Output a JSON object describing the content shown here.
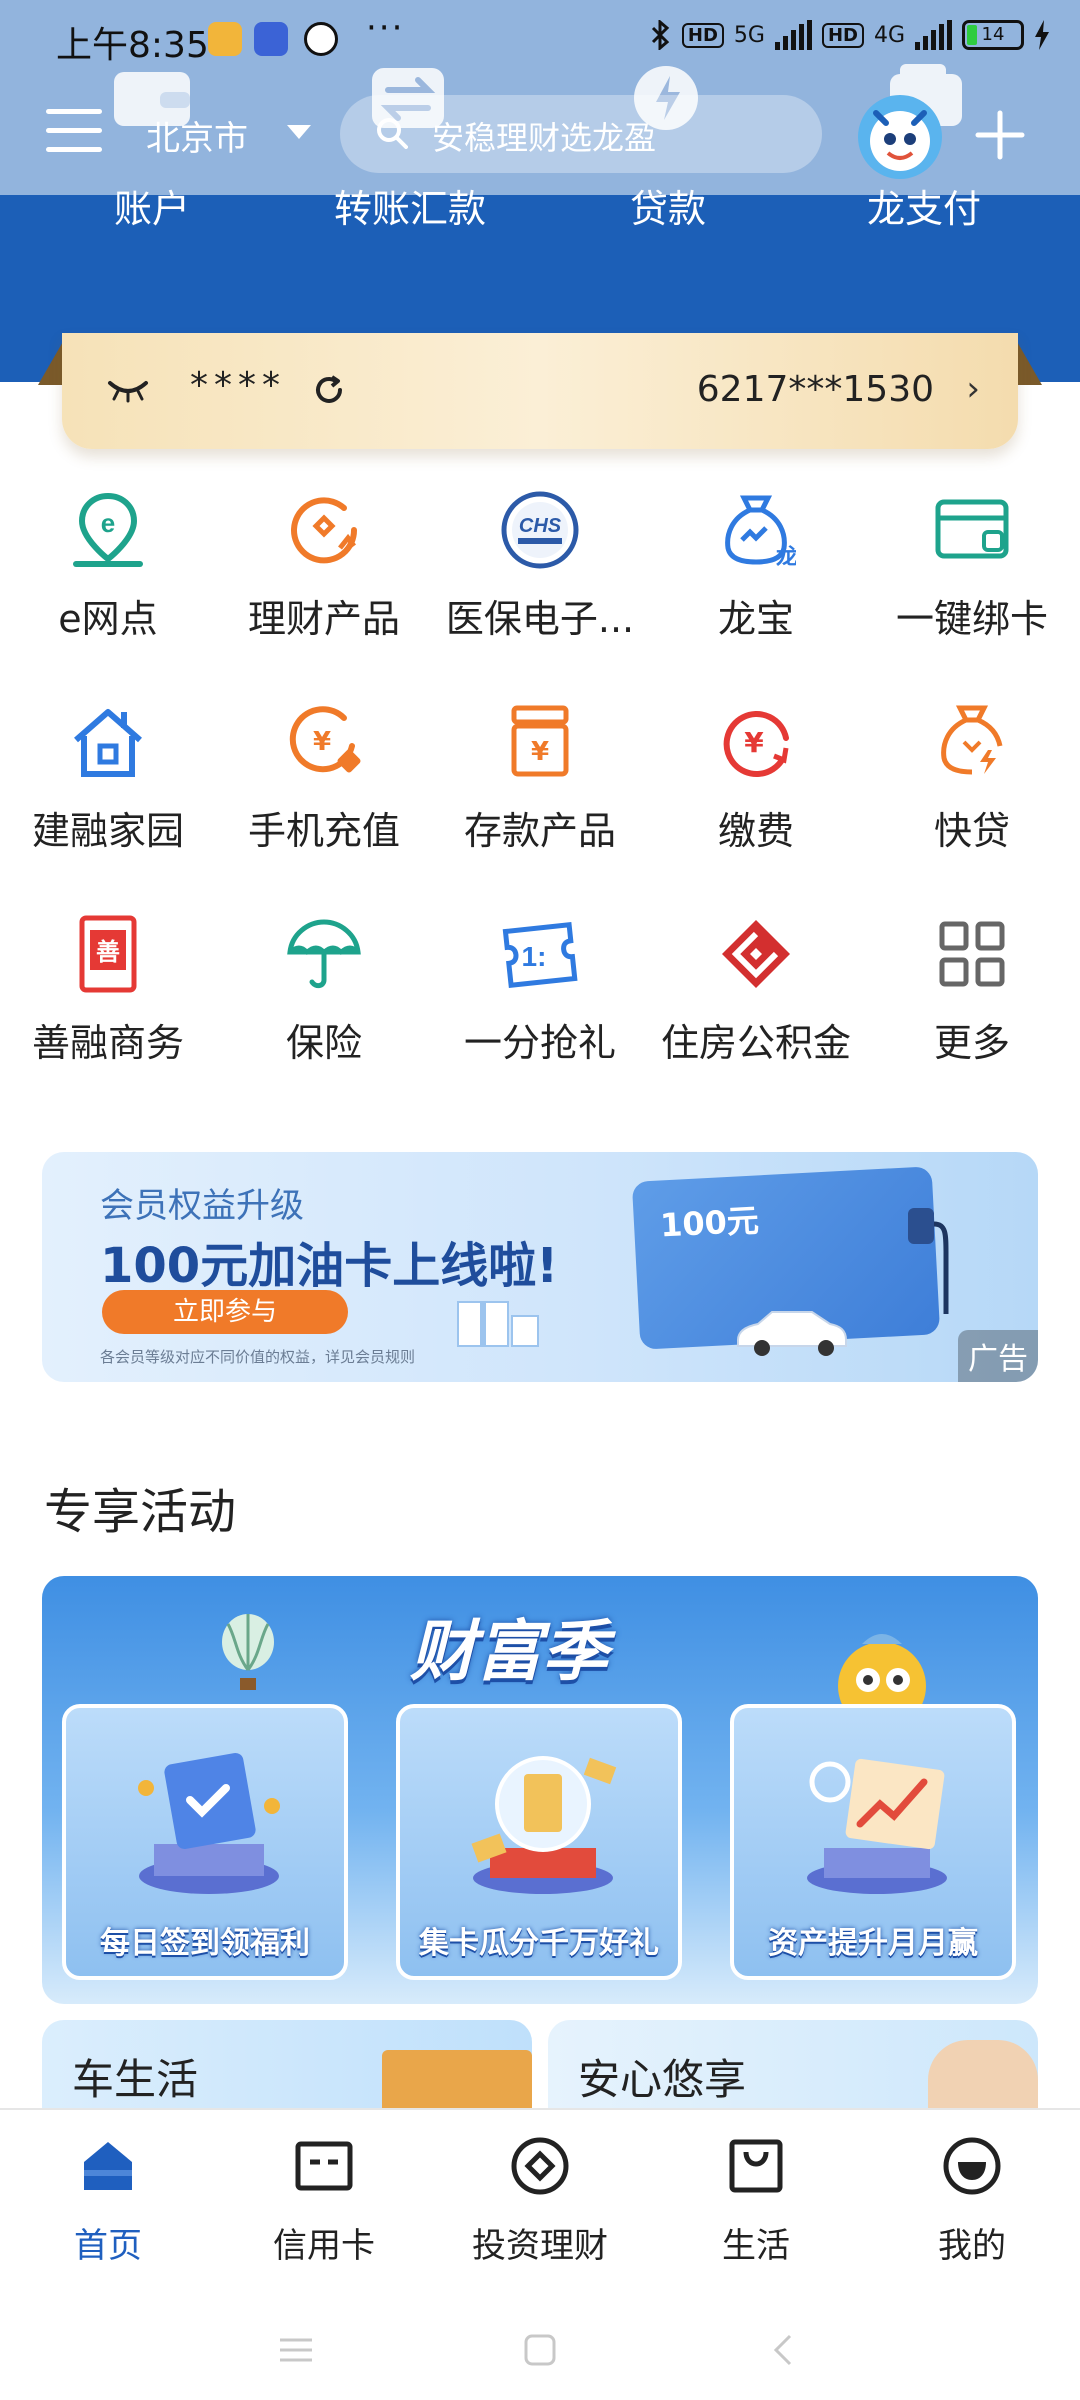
{
  "status_bar": {
    "time": "上午8:35",
    "dots": "···",
    "signal_1": "5G",
    "signal_2": "4G",
    "hd": "HD",
    "battery": "14"
  },
  "header": {
    "city": "北京市",
    "search_placeholder": "安稳理财选龙盈",
    "quick_nav": [
      {
        "label": "账户",
        "icon": "wallet-icon"
      },
      {
        "label": "转账汇款",
        "icon": "transfer-icon"
      },
      {
        "label": "贷款",
        "icon": "loan-icon"
      },
      {
        "label": "龙支付",
        "icon": "pay-icon"
      }
    ]
  },
  "account_card": {
    "masked_balance": "****",
    "card_number": "6217***1530"
  },
  "services": [
    {
      "label": "e网点",
      "icon": "location-e-icon",
      "color": "#1ea38c"
    },
    {
      "label": "理财产品",
      "icon": "wealth-product-icon",
      "color": "#f07a29"
    },
    {
      "label": "医保电子...",
      "icon": "medical-insurance-icon",
      "color": "#2c5aa8"
    },
    {
      "label": "龙宝",
      "icon": "longbao-bag-icon",
      "color": "#2f7ae0"
    },
    {
      "label": "一键绑卡",
      "icon": "bind-card-icon",
      "color": "#1ea38c"
    },
    {
      "label": "建融家园",
      "icon": "home-icon",
      "color": "#2f7ae0"
    },
    {
      "label": "手机充值",
      "icon": "phone-topup-icon",
      "color": "#f07a29"
    },
    {
      "label": "存款产品",
      "icon": "deposit-icon",
      "color": "#f07a29"
    },
    {
      "label": "缴费",
      "icon": "payment-icon",
      "color": "#e53935"
    },
    {
      "label": "快贷",
      "icon": "quick-loan-icon",
      "color": "#f07a29"
    },
    {
      "label": "善融商务",
      "icon": "shanrong-icon",
      "color": "#e53935"
    },
    {
      "label": "保险",
      "icon": "umbrella-icon",
      "color": "#1ea38c"
    },
    {
      "label": "一分抢礼",
      "icon": "ticket-icon",
      "color": "#2f7ae0"
    },
    {
      "label": "住房公积金",
      "icon": "housing-fund-icon",
      "color": "#d32f2f"
    },
    {
      "label": "更多",
      "icon": "more-grid-icon",
      "color": "#666666"
    }
  ],
  "ad_banner": {
    "subtitle": "会员权益升级",
    "title": "100元加油卡上线啦!",
    "button": "立即参与",
    "note": "各会员等级对应不同价值的权益，详见会员规则",
    "card_value": "100元",
    "tag": "广告"
  },
  "activities": {
    "section_title": "专享活动",
    "banner_title": "财富季",
    "cards": [
      {
        "label": "每日签到领福利",
        "icon": "calendar-check-icon"
      },
      {
        "label": "集卡瓜分千万好礼",
        "icon": "gift-card-icon"
      },
      {
        "label": "资产提升月月赢",
        "icon": "growth-chart-icon"
      }
    ],
    "tiles": [
      {
        "label": "车生活"
      },
      {
        "label": "安心悠享"
      }
    ]
  },
  "bottom_nav": [
    {
      "label": "首页",
      "icon": "home-nav-icon",
      "active": true
    },
    {
      "label": "信用卡",
      "icon": "credit-card-icon",
      "active": false
    },
    {
      "label": "投资理财",
      "icon": "invest-icon",
      "active": false
    },
    {
      "label": "生活",
      "icon": "shopping-bag-icon",
      "active": false
    },
    {
      "label": "我的",
      "icon": "profile-icon",
      "active": false
    }
  ],
  "colors": {
    "brand_blue": "#1c5fb7",
    "header_light": "#92b4dd",
    "accent_orange": "#f07a29",
    "active_nav": "#1f5fbf"
  }
}
